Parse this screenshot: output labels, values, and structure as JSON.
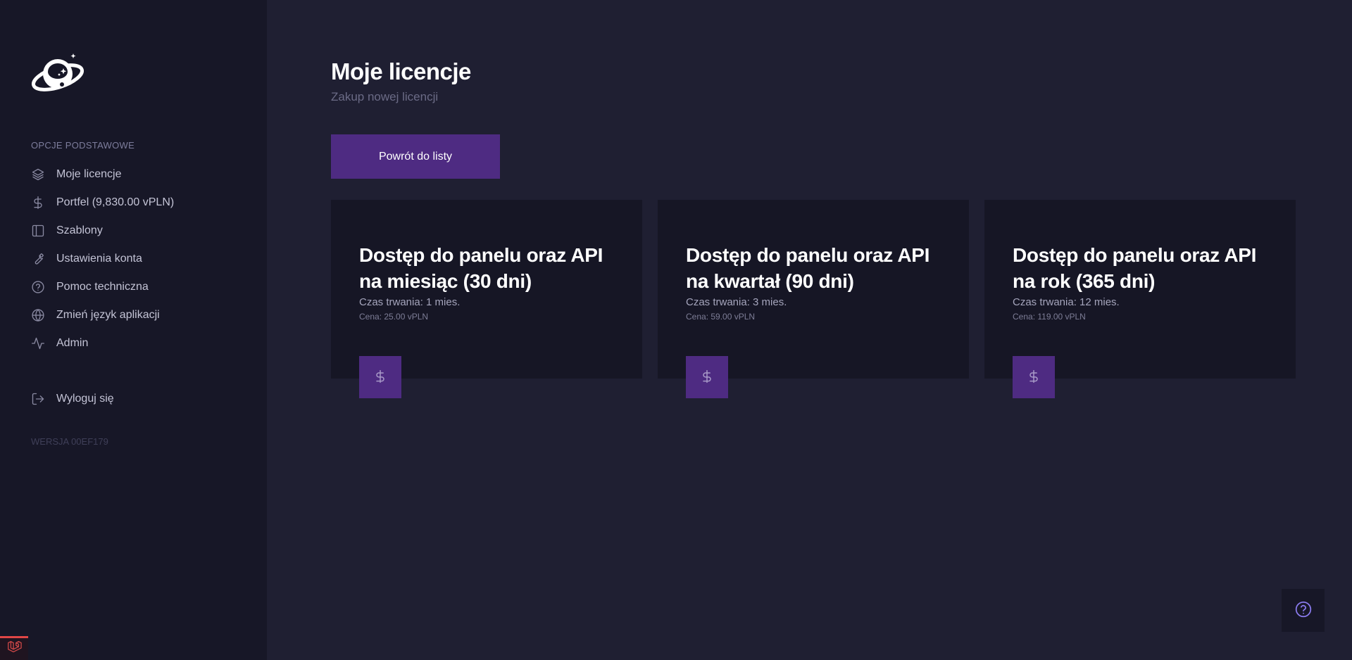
{
  "sidebar": {
    "logo_icon": "astronaut-planet-logo",
    "section_label": "OPCJE PODSTAWOWE",
    "items": [
      {
        "label": "Moje licencje",
        "icon": "layers-icon"
      },
      {
        "label": "Portfel (9,830.00 vPLN)",
        "icon": "dollar-icon"
      },
      {
        "label": "Szablony",
        "icon": "layout-icon"
      },
      {
        "label": "Ustawienia konta",
        "icon": "wrench-icon"
      },
      {
        "label": "Pomoc techniczna",
        "icon": "help-circle-icon"
      },
      {
        "label": "Zmień język aplikacji",
        "icon": "globe-icon"
      },
      {
        "label": "Admin",
        "icon": "activity-icon"
      }
    ],
    "logout_label": "Wyloguj się",
    "version": "WERSJA 00EF179"
  },
  "header": {
    "title": "Moje licencje",
    "subtitle": "Zakup nowej licencji",
    "back_button_label": "Powrót do listy"
  },
  "plans": [
    {
      "title": "Dostęp do panelu oraz API na miesiąc (30 dni)",
      "duration": "Czas trwania: 1 mies.",
      "price": "Cena: 25.00 vPLN",
      "button_icon": "$"
    },
    {
      "title": "Dostęp do panelu oraz API na kwartał (90 dni)",
      "duration": "Czas trwania: 3 mies.",
      "price": "Cena: 59.00 vPLN",
      "button_icon": "$"
    },
    {
      "title": "Dostęp do panelu oraz API na rok (365 dni)",
      "duration": "Czas trwania: 12 mies.",
      "price": "Cena: 119.00 vPLN",
      "button_icon": "$"
    }
  ],
  "colors": {
    "accent": "#4e2b82",
    "background": "#1f1f32",
    "sidebar": "#171727",
    "card": "#161625",
    "help_icon": "#8b7cf0"
  }
}
